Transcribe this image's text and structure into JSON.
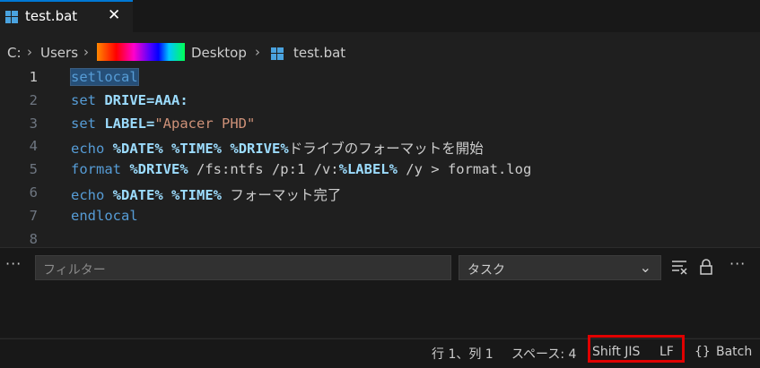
{
  "tab": {
    "icon": "windows-batch-file-icon",
    "label": "test.bat",
    "close": "✕"
  },
  "breadcrumb": {
    "drive": "C:",
    "users": "Users",
    "redacted_color": "rainbow",
    "desktop": "Desktop",
    "file": "test.bat"
  },
  "editor": {
    "active_line": 1,
    "lines": [
      {
        "number": "1",
        "tokens": [
          {
            "t": "setlocal",
            "c": "kw sel"
          }
        ]
      },
      {
        "number": "2",
        "tokens": [
          {
            "t": "set ",
            "c": "kw"
          },
          {
            "t": "DRIVE=AAA:",
            "c": "var"
          }
        ]
      },
      {
        "number": "3",
        "tokens": [
          {
            "t": "set ",
            "c": "kw"
          },
          {
            "t": "LABEL=",
            "c": "var"
          },
          {
            "t": "\"Apacer PHD\"",
            "c": "str"
          }
        ]
      },
      {
        "number": "4",
        "tokens": [
          {
            "t": "echo ",
            "c": "kw"
          },
          {
            "t": "%DATE%",
            "c": "var"
          },
          {
            "t": " ",
            "c": "txt"
          },
          {
            "t": "%TIME%",
            "c": "var"
          },
          {
            "t": " ",
            "c": "txt"
          },
          {
            "t": "%DRIVE%",
            "c": "var"
          },
          {
            "t": "ドライブのフォーマットを開始",
            "c": "txt jp"
          }
        ]
      },
      {
        "number": "5",
        "tokens": [
          {
            "t": "format ",
            "c": "kw"
          },
          {
            "t": "%DRIVE%",
            "c": "var"
          },
          {
            "t": " /fs:ntfs /p:1 /v:",
            "c": "txt"
          },
          {
            "t": "%LABEL%",
            "c": "var"
          },
          {
            "t": " /y > format.log",
            "c": "txt"
          }
        ]
      },
      {
        "number": "6",
        "tokens": [
          {
            "t": "echo ",
            "c": "kw"
          },
          {
            "t": "%DATE%",
            "c": "var"
          },
          {
            "t": " ",
            "c": "txt"
          },
          {
            "t": "%TIME%",
            "c": "var"
          },
          {
            "t": " ",
            "c": "txt"
          },
          {
            "t": "フォーマット完了",
            "c": "txt jp"
          }
        ]
      },
      {
        "number": "7",
        "tokens": [
          {
            "t": "endlocal",
            "c": "kw"
          }
        ]
      },
      {
        "number": "8",
        "tokens": []
      }
    ]
  },
  "panel": {
    "more": "···",
    "filter_placeholder": "フィルター",
    "task_select": "タスク"
  },
  "statusbar": {
    "position": "行 1、列 1",
    "spaces": "スペース: 4",
    "encoding": "Shift JIS",
    "eol": "LF",
    "language_icon": "{}",
    "language": "Batch"
  },
  "colors": {
    "keyword": "#569cd6",
    "variable": "#9cdcfe",
    "string": "#ce9178",
    "highlight_box": "#e00000",
    "tab_accent": "#0078d4"
  }
}
